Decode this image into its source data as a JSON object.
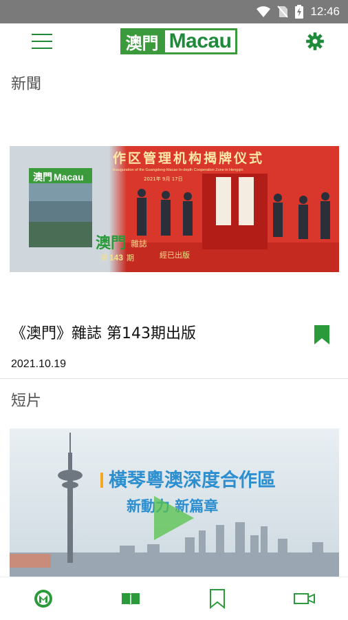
{
  "status_bar": {
    "time": "12:46",
    "icons": [
      "wifi-icon",
      "no-sim-icon",
      "battery-charging-icon"
    ]
  },
  "app_bar": {
    "menu_icon": "hamburger-menu-icon",
    "logo_cn": "澳門",
    "logo_en": "Macau",
    "settings_icon": "gear-icon",
    "accent_color": "#1f8a3a"
  },
  "news_section": {
    "title": "新聞",
    "card": {
      "image_banner_text": "作区管理机构揭牌仪式",
      "image_sub_text": "Inauguration of the Guangdong-Macao In-depth Cooperation Zone in Hengqin",
      "image_date_text": "2021年 9月 17日",
      "magazine_logo_cn": "澳門",
      "magazine_logo_en": "Macau",
      "magazine_title": "澳門",
      "magazine_label": "雜誌",
      "magazine_issue_prefix": "第",
      "magazine_issue": "143",
      "magazine_issue_suffix": "期",
      "magazine_published": "經已出版",
      "headline": "《澳門》雜誌 第143期出版",
      "date": "2021.10.19",
      "bookmark_icon": "bookmark-filled-icon"
    }
  },
  "video_section": {
    "title": "短片",
    "card": {
      "overlay_title": "橫琴粵澳深度合作區",
      "overlay_subtitle": "新動力 新篇章",
      "play_icon": "play-icon"
    }
  },
  "bottom_nav": {
    "items": [
      {
        "icon": "macau-m-logo-icon",
        "active": true
      },
      {
        "icon": "magazine-book-icon",
        "active": false
      },
      {
        "icon": "bookmark-outline-icon",
        "active": false
      },
      {
        "icon": "video-camera-icon",
        "active": false
      }
    ]
  }
}
